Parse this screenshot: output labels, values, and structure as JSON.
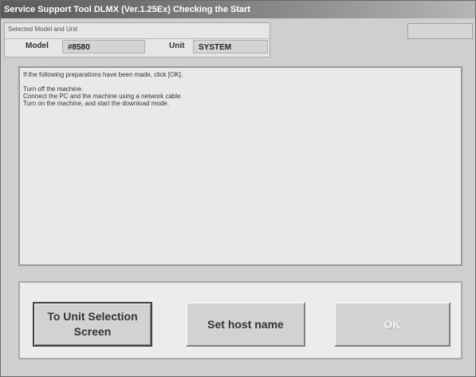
{
  "window": {
    "title": "Service Support Tool DLMX (Ver.1.25Ex) Checking the Start"
  },
  "info_panel": {
    "caption": "Selected Model and Unit",
    "model_label": "Model",
    "model_value": "#8580",
    "unit_label": "Unit",
    "unit_value": "SYSTEM"
  },
  "message": {
    "line1": "If the following preparations have been made, click [OK].",
    "line2": "Turn off the machine.",
    "line3": "Connect the PC and the machine using a network cable.",
    "line4": "Turn on the machine, and start the download mode."
  },
  "buttons": {
    "unit_selection_line1": "To Unit Selection",
    "unit_selection_line2": "Screen",
    "set_host_name": "Set host name",
    "ok": "OK",
    "ok_enabled": false
  }
}
